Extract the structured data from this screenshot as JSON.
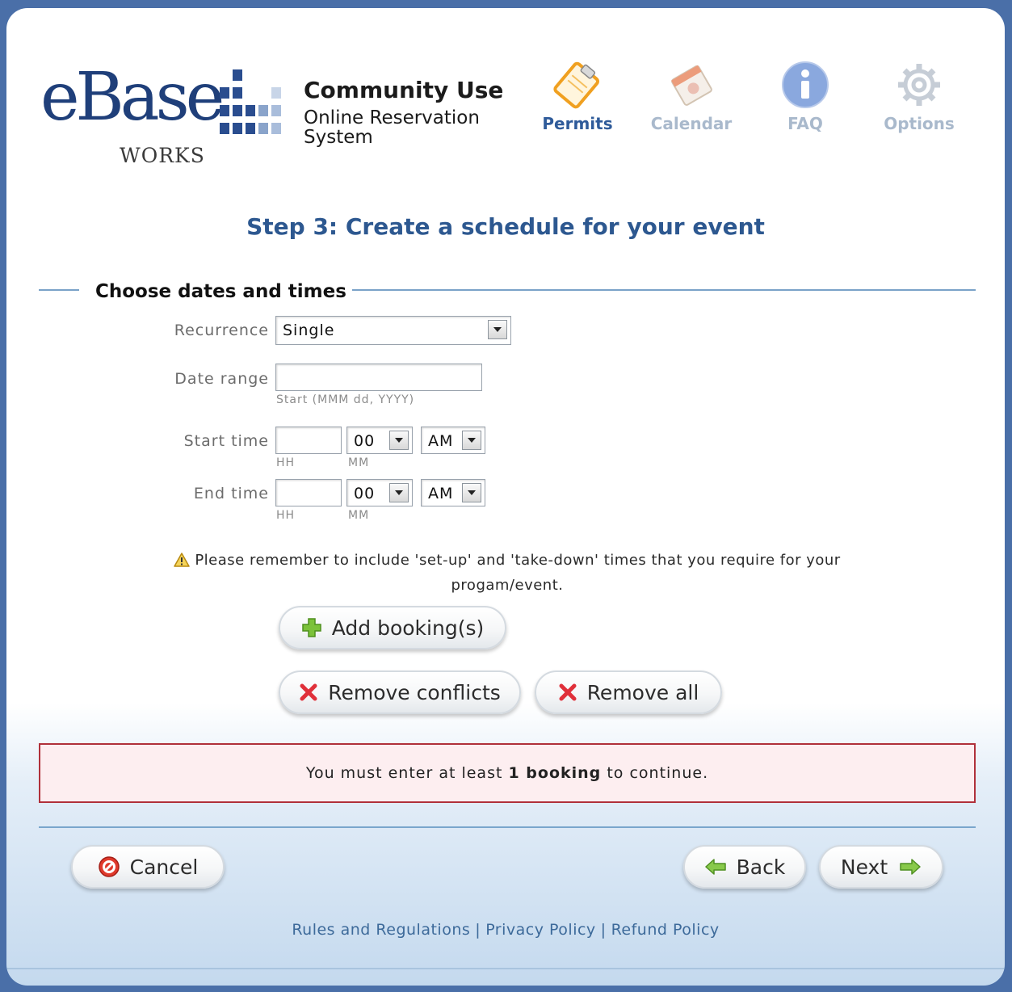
{
  "logo": {
    "wordmark": "eBase",
    "sub": "WORKS"
  },
  "brand": {
    "title": "Community Use",
    "subtitle_line1": "Online Reservation",
    "subtitle_line2": "System"
  },
  "nav": [
    {
      "label": "Permits",
      "icon": "clipboard-icon",
      "active": true
    },
    {
      "label": "Calendar",
      "icon": "calendar-icon",
      "active": false
    },
    {
      "label": "FAQ",
      "icon": "info-icon",
      "active": false
    },
    {
      "label": "Options",
      "icon": "gear-icon",
      "active": false
    }
  ],
  "step_title": "Step 3: Create a schedule for your event",
  "section_title": "Choose dates and times",
  "form": {
    "recurrence_label": "Recurrence",
    "recurrence_value": "Single",
    "date_range_label": "Date range",
    "date_range_value": "",
    "date_hint": "Start (MMM dd, YYYY)",
    "start_time_label": "Start time",
    "start_hour": "",
    "start_minute": "00",
    "start_ampm": "AM",
    "end_time_label": "End time",
    "end_hour": "",
    "end_minute": "00",
    "end_ampm": "AM",
    "hh_hint": "HH",
    "mm_hint": "MM"
  },
  "note": "Please remember to include 'set-up' and 'take-down' times that you require for your progam/event.",
  "buttons": {
    "add": "Add booking(s)",
    "remove_conflicts": "Remove conflicts",
    "remove_all": "Remove all",
    "cancel": "Cancel",
    "back": "Back",
    "next": "Next"
  },
  "error": {
    "pre": "You must enter at least ",
    "bold": "1 booking",
    "post": " to continue."
  },
  "footer": {
    "link1": "Rules and Regulations",
    "link2": "Privacy Policy",
    "link3": "Refund Policy",
    "separator": "|"
  },
  "colors": {
    "brand_blue": "#1f3f7a",
    "nav_active": "#2f5b9a",
    "nav_inactive": "#a9b9cc",
    "error_border": "#b0303a",
    "error_bg": "#fdeef0"
  }
}
